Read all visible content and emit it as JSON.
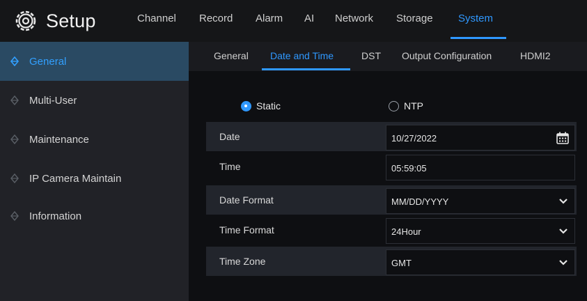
{
  "app": {
    "title": "Setup"
  },
  "top_tabs": [
    {
      "label": "Channel"
    },
    {
      "label": "Record"
    },
    {
      "label": "Alarm"
    },
    {
      "label": "AI"
    },
    {
      "label": "Network"
    },
    {
      "label": "Storage"
    },
    {
      "label": "System",
      "active": true
    }
  ],
  "sidebar": {
    "items": [
      {
        "label": "General",
        "active": true
      },
      {
        "label": "Multi-User"
      },
      {
        "label": "Maintenance"
      },
      {
        "label": "IP Camera Maintain"
      },
      {
        "label": "Information"
      }
    ]
  },
  "sub_tabs": [
    {
      "label": "General"
    },
    {
      "label": "Date and Time",
      "active": true
    },
    {
      "label": "DST"
    },
    {
      "label": "Output Configuration"
    },
    {
      "label": "HDMI2"
    }
  ],
  "mode": {
    "options": [
      {
        "label": "Static",
        "selected": true
      },
      {
        "label": "NTP",
        "selected": false
      }
    ]
  },
  "fields": {
    "date": {
      "label": "Date",
      "value": "10/27/2022",
      "icon": "calendar-icon"
    },
    "time": {
      "label": "Time",
      "value": "05:59:05"
    },
    "date_format": {
      "label": "Date Format",
      "value": "MM/DD/YYYY"
    },
    "time_format": {
      "label": "Time Format",
      "value": "24Hour"
    },
    "time_zone": {
      "label": "Time Zone",
      "value": "GMT"
    }
  },
  "colors": {
    "accent": "#2f98ff",
    "sidebar_active_bg": "#2a4a63",
    "background": "#0e0f12"
  }
}
